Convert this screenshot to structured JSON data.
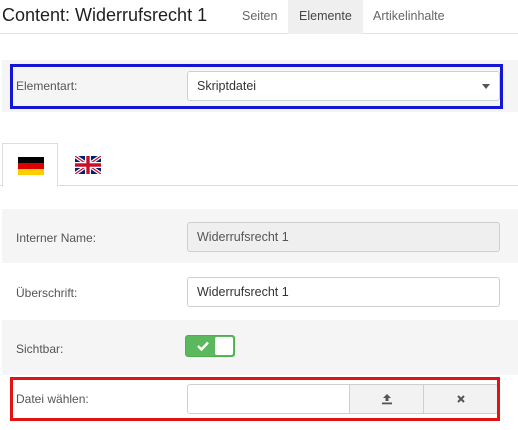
{
  "header": {
    "title": "Content: Widerrufsrecht 1",
    "tabs": [
      {
        "label": "Seiten",
        "active": false
      },
      {
        "label": "Elemente",
        "active": true
      },
      {
        "label": "Artikelinhalte",
        "active": false
      }
    ]
  },
  "element_type": {
    "label": "Elementart:",
    "value": "Skriptdatei"
  },
  "languages": [
    {
      "icon": "german-flag-icon",
      "active": true
    },
    {
      "icon": "uk-flag-icon",
      "active": false
    }
  ],
  "form": {
    "internal_name": {
      "label": "Interner Name:",
      "value": "Widerrufsrecht 1"
    },
    "heading": {
      "label": "Überschrift:",
      "value": "Widerrufsrecht 1"
    },
    "visible": {
      "label": "Sichtbar:",
      "on": true
    },
    "file": {
      "label": "Datei wählen:",
      "value": "",
      "upload_icon": "upload-icon",
      "clear_icon": "close-icon"
    }
  },
  "colors": {
    "highlight_blue": "#1515d6",
    "highlight_red": "#e01414",
    "toggle_on": "#5cb85c"
  }
}
